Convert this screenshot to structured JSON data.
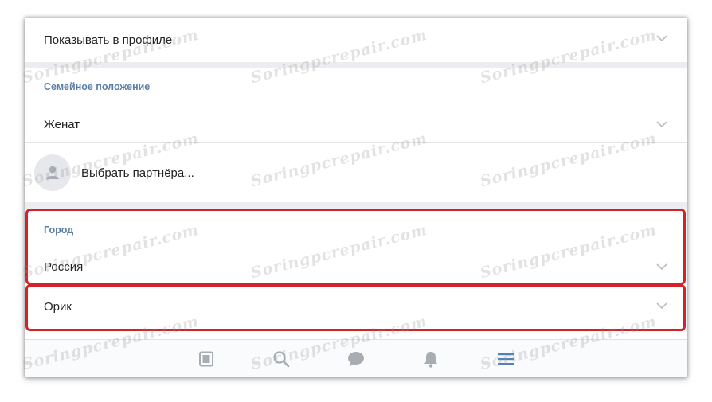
{
  "profile": {
    "show_in_profile_label": "Показывать в профиле",
    "family_status": {
      "section_label": "Семейное положение",
      "value": "Женат"
    },
    "partner": {
      "label": "Выбрать партнёра..."
    },
    "city": {
      "section_label": "Город",
      "country_value": "Россия",
      "city_value": "Орик"
    }
  },
  "navbar": {
    "items": [
      "news-icon",
      "search-icon",
      "messages-icon",
      "notifications-icon",
      "menu-icon"
    ],
    "active": "menu-icon"
  },
  "watermark": "Soringpcrepair.com",
  "colors": {
    "section_label": "#5b7fa6",
    "highlight": "#d2232a",
    "active_nav": "#5181b8",
    "nav_icon": "#a8adb4"
  }
}
